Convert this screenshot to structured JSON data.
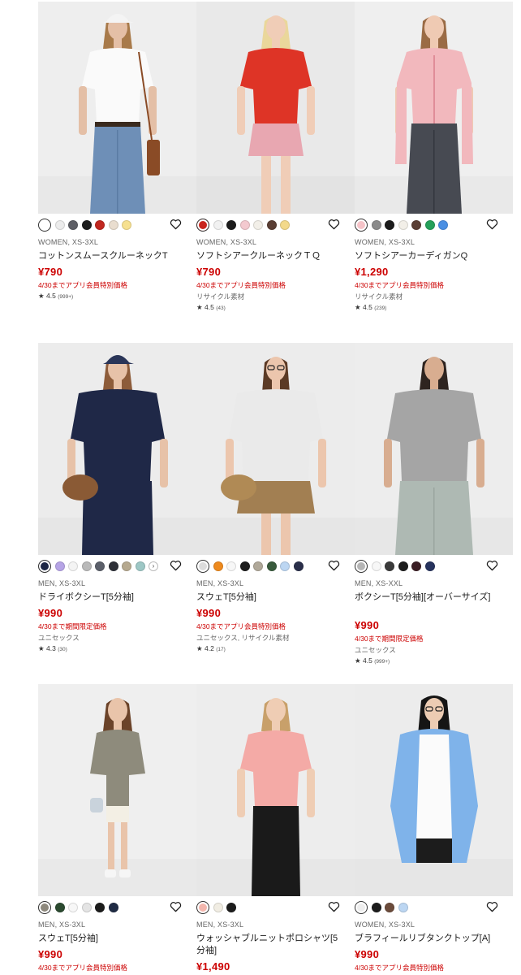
{
  "products": [
    {
      "meta": "WOMEN, XS-3XL",
      "name": "コットンスムースクルーネックT",
      "price": "¥790",
      "promo": "4/30までアプリ会員特別価格",
      "extra": "",
      "rating": {
        "score": "4.5",
        "count": "(999+)"
      },
      "swatches": [
        "#ffffff",
        "#ececec",
        "#5e5f66",
        "#1c1c1c",
        "#c1271f",
        "#e9ddcf",
        "#f6e08f"
      ],
      "photo": {
        "bg": "#eeeeee",
        "top": "#fafafa",
        "bottom": "#6e8fb7",
        "skin": "#e4bfa6",
        "hair": "#a87a4a",
        "hat": "#f4f4f4",
        "bag": "#8a4b26",
        "style": "tee-jeans"
      }
    },
    {
      "meta": "WOMEN, XS-3XL",
      "name": "ソフトシアークルーネックＴＱ",
      "price": "¥790",
      "promo": "4/30までアプリ会員特別価格",
      "extra": "リサイクル素材",
      "rating": {
        "score": "4.5",
        "count": "(43)"
      },
      "swatches": [
        "#c9261f",
        "#f1f1f1",
        "#1c1c1c",
        "#f3c9cf",
        "#f2efe8",
        "#5a3e34",
        "#f3d98a"
      ],
      "photo": {
        "bg": "#e9e9e9",
        "top": "#de3426",
        "bottom": "#e8a7b1",
        "skin": "#f0cdb7",
        "hair": "#ead79b",
        "hat": "",
        "bag": "",
        "style": "tee-shorts"
      }
    },
    {
      "meta": "WOMEN, XS-3XL",
      "name": "ソフトシアーカーディガンQ",
      "price": "¥1,290",
      "promo": "4/30までアプリ会員特別価格",
      "extra": "リサイクル素材",
      "rating": {
        "score": "4.5",
        "count": "(239)"
      },
      "swatches": [
        "#f5c3c8",
        "#8b8b8b",
        "#1c1c1c",
        "#f2efe8",
        "#5a3e34",
        "#25a05a",
        "#4a8fe3"
      ],
      "photo": {
        "bg": "#efefef",
        "top": "#f2b8bd",
        "bottom": "#474a52",
        "skin": "#efcab3",
        "hair": "#9a6b45",
        "hat": "",
        "bag": "",
        "style": "cardigan"
      }
    },
    {
      "meta": "MEN, XS-3XL",
      "name": "ドライボクシーT[5分袖]",
      "price": "¥990",
      "promo": "4/30まで期間限定価格",
      "extra": "ユニセックス",
      "rating": {
        "score": "4.3",
        "count": "(30)"
      },
      "swatches": [
        "#1c2544",
        "#b6a4e6",
        "#f4f4f4",
        "#b9b9b9",
        "#5b5f6a",
        "#2e3038",
        "#b6a98f",
        "#9dc7c5"
      ],
      "photo": {
        "bg": "#ececec",
        "top": "#1f2847",
        "bottom": "#1f2847",
        "skin": "#e7c2a8",
        "hair": "#8d5c3a",
        "hat": "#2a3558",
        "bag": "#8a5a35",
        "style": "boxy-skirt"
      }
    },
    {
      "meta": "MEN, XS-3XL",
      "name": "スウェT[5分袖]",
      "price": "¥990",
      "promo": "4/30までアプリ会員特別価格",
      "extra": "ユニセックス, リサイクル素材",
      "rating": {
        "score": "4.2",
        "count": "(17)"
      },
      "swatches": [
        "#dcdcdc",
        "#ee8a1e",
        "#f7f7f7",
        "#1c1c1c",
        "#b0a899",
        "#385a3c",
        "#bcd6f2",
        "#2a2f4a"
      ],
      "photo": {
        "bg": "#ececec",
        "top": "#eaeaea",
        "bottom": "#a27f52",
        "skin": "#ecc6ad",
        "hair": "#5b3a25",
        "hat": "",
        "bag": "#b08a55",
        "style": "sweat-skirt"
      }
    },
    {
      "meta": "MEN, XS-XXL",
      "name": "ボクシーT[5分袖][オーバーサイズ]",
      "price": "¥990",
      "promo": "4/30まで期間限定価格",
      "extra": "ユニセックス",
      "rating": {
        "score": "4.5",
        "count": "(999+)"
      },
      "swatches": [
        "#b5b5b5",
        "#f7f7f7",
        "#3b3b3b",
        "#1c1c1c",
        "#3b1e24",
        "#27335e"
      ],
      "photo": {
        "bg": "#ededed",
        "top": "#a5a5a5",
        "bottom": "#aeb9b3",
        "skin": "#d8ad90",
        "hair": "#2e2420",
        "hat": "",
        "bag": "",
        "style": "oversize-jeans"
      }
    },
    {
      "meta": "MEN, XS-3XL",
      "name": "スウェT[5分袖]",
      "price": "¥990",
      "promo": "4/30までアプリ会員特別価格",
      "extra": "",
      "rating": {
        "score": "",
        "count": ""
      },
      "swatches": [
        "#8d887c",
        "#2b4a30",
        "#f7f7f7",
        "#e4e4e4",
        "#1c1c1c",
        "#1f2b44"
      ],
      "photo": {
        "bg": "#efefef",
        "top": "#8e8b7c",
        "bottom": "#f3efe4",
        "skin": "#e9c4aa",
        "hair": "#6b4329",
        "hat": "",
        "bag": "#c9d3dc",
        "style": "full-sweat"
      }
    },
    {
      "meta": "MEN, XS-3XL",
      "name": "ウォッシャブルニットポロシャツ[5分袖]",
      "price": "¥1,490",
      "promo": "",
      "extra": "",
      "rating": {
        "score": "",
        "count": ""
      },
      "swatches": [
        "#f3b6ad",
        "#f1ede3",
        "#1c1c1c"
      ],
      "photo": {
        "bg": "#ededed",
        "top": "#f4aaa6",
        "bottom": "#1a1a1a",
        "skin": "#efcdb4",
        "hair": "#c8a06a",
        "hat": "",
        "bag": "",
        "style": "polo"
      }
    },
    {
      "meta": "WOMEN, XS-3XL",
      "name": "ブラフィールリブタンクトップ[A]",
      "price": "¥990",
      "promo": "4/30までアプリ会員特別価格",
      "extra": "",
      "rating": {
        "score": "",
        "count": ""
      },
      "swatches": [
        "#ededed",
        "#1c1c1c",
        "#6b4b3b",
        "#bcd6f2"
      ],
      "photo": {
        "bg": "#ececec",
        "top": "#fbfbfb",
        "bottom": "#1c1c1c",
        "skin": "#ecccb3",
        "hair": "#151515",
        "hat": "",
        "bag": "#7fb3ea",
        "style": "tank-shirt"
      }
    }
  ]
}
